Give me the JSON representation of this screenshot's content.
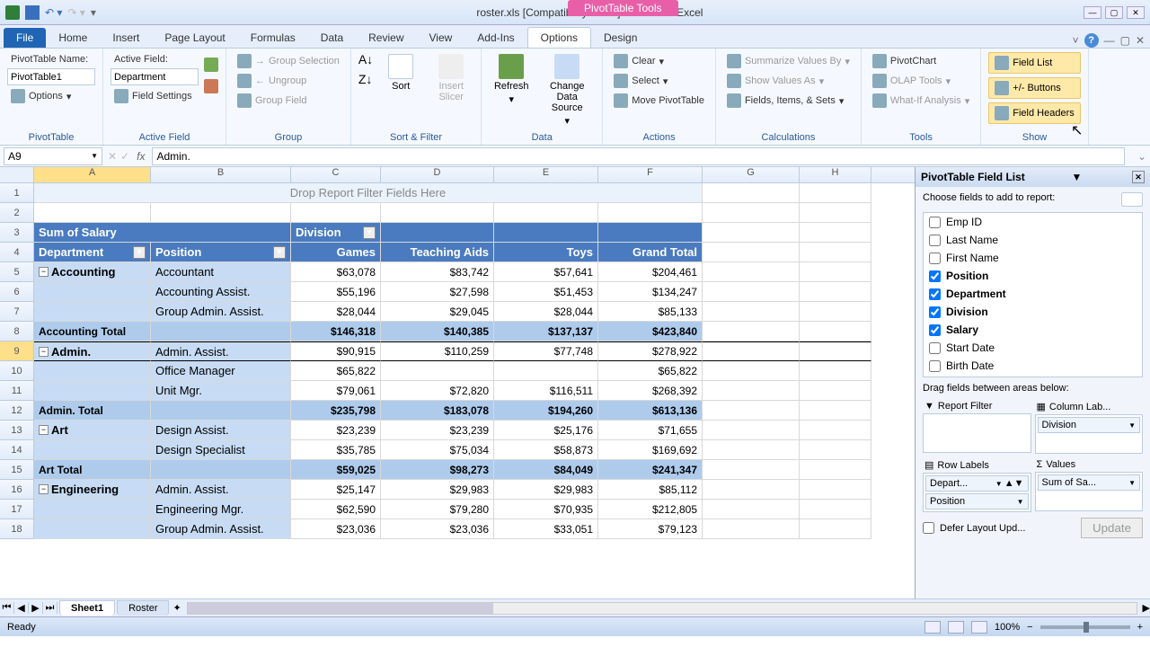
{
  "window": {
    "title": "roster.xls  [Compatibility Mode] - Microsoft Excel",
    "contextTab": "PivotTable Tools"
  },
  "tabs": [
    "File",
    "Home",
    "Insert",
    "Page Layout",
    "Formulas",
    "Data",
    "Review",
    "View",
    "Add-Ins",
    "Options",
    "Design"
  ],
  "ribbon": {
    "pivottable": {
      "nameLabel": "PivotTable Name:",
      "name": "PivotTable1",
      "options": "Options",
      "group": "PivotTable"
    },
    "activefield": {
      "label": "Active Field:",
      "value": "Department",
      "settings": "Field Settings",
      "group": "Active Field"
    },
    "group": {
      "sel": "Group Selection",
      "ungroup": "Ungroup",
      "field": "Group Field",
      "group": "Group"
    },
    "sortfilter": {
      "sort": "Sort",
      "slicer": "Insert Slicer",
      "group": "Sort & Filter"
    },
    "data": {
      "refresh": "Refresh",
      "change": "Change Data Source",
      "group": "Data"
    },
    "actions": {
      "clear": "Clear",
      "select": "Select",
      "move": "Move PivotTable",
      "group": "Actions"
    },
    "calc": {
      "summarize": "Summarize Values By",
      "showas": "Show Values As",
      "fields": "Fields, Items, & Sets",
      "group": "Calculations"
    },
    "tools": {
      "chart": "PivotChart",
      "olap": "OLAP Tools",
      "whatif": "What-If Analysis",
      "group": "Tools"
    },
    "show": {
      "list": "Field List",
      "buttons": "+/- Buttons",
      "headers": "Field Headers",
      "group": "Show"
    }
  },
  "fbar": {
    "name": "A9",
    "formula": "Admin."
  },
  "colLetters": [
    "A",
    "B",
    "C",
    "D",
    "E",
    "F",
    "G",
    "H"
  ],
  "pivot": {
    "filterDrop": "Drop Report Filter Fields Here",
    "corner": "Sum of Salary",
    "colField": "Division",
    "rowFields": [
      "Department",
      "Position"
    ],
    "cols": [
      "Games",
      "Teaching Aids",
      "Toys",
      "Grand Total"
    ]
  },
  "chart_data": {
    "type": "table",
    "value_field": "Sum of Salary",
    "column_field": "Division",
    "columns": [
      "Games",
      "Teaching Aids",
      "Toys",
      "Grand Total"
    ],
    "rows": [
      {
        "dept": "Accounting",
        "pos": "Accountant",
        "vals": [
          "$63,078",
          "$83,742",
          "$57,641",
          "$204,461"
        ]
      },
      {
        "dept": "Accounting",
        "pos": "Accounting Assist.",
        "vals": [
          "$55,196",
          "$27,598",
          "$51,453",
          "$134,247"
        ]
      },
      {
        "dept": "Accounting",
        "pos": "Group Admin. Assist.",
        "vals": [
          "$28,044",
          "$29,045",
          "$28,044",
          "$85,133"
        ]
      },
      {
        "dept": "Accounting Total",
        "subtotal": true,
        "vals": [
          "$146,318",
          "$140,385",
          "$137,137",
          "$423,840"
        ]
      },
      {
        "dept": "Admin.",
        "pos": "Admin. Assist.",
        "vals": [
          "$90,915",
          "$110,259",
          "$77,748",
          "$278,922"
        ]
      },
      {
        "dept": "Admin.",
        "pos": "Office Manager",
        "vals": [
          "$65,822",
          "",
          "",
          "$65,822"
        ]
      },
      {
        "dept": "Admin.",
        "pos": "Unit Mgr.",
        "vals": [
          "$79,061",
          "$72,820",
          "$116,511",
          "$268,392"
        ]
      },
      {
        "dept": "Admin. Total",
        "subtotal": true,
        "vals": [
          "$235,798",
          "$183,078",
          "$194,260",
          "$613,136"
        ]
      },
      {
        "dept": "Art",
        "pos": "Design Assist.",
        "vals": [
          "$23,239",
          "$23,239",
          "$25,176",
          "$71,655"
        ]
      },
      {
        "dept": "Art",
        "pos": "Design Specialist",
        "vals": [
          "$35,785",
          "$75,034",
          "$58,873",
          "$169,692"
        ]
      },
      {
        "dept": "Art Total",
        "subtotal": true,
        "vals": [
          "$59,025",
          "$98,273",
          "$84,049",
          "$241,347"
        ]
      },
      {
        "dept": "Engineering",
        "pos": "Admin. Assist.",
        "vals": [
          "$25,147",
          "$29,983",
          "$29,983",
          "$85,112"
        ]
      },
      {
        "dept": "Engineering",
        "pos": "Engineering Mgr.",
        "vals": [
          "$62,590",
          "$79,280",
          "$70,935",
          "$212,805"
        ]
      },
      {
        "dept": "Engineering",
        "pos": "Group Admin. Assist.",
        "vals": [
          "$23,036",
          "$23,036",
          "$33,051",
          "$79,123"
        ]
      }
    ]
  },
  "fieldlist": {
    "title": "PivotTable Field List",
    "instr": "Choose fields to add to report:",
    "fields": [
      {
        "name": "Emp ID",
        "checked": false
      },
      {
        "name": "Last Name",
        "checked": false
      },
      {
        "name": "First Name",
        "checked": false
      },
      {
        "name": "Position",
        "checked": true
      },
      {
        "name": "Department",
        "checked": true
      },
      {
        "name": "Division",
        "checked": true
      },
      {
        "name": "Salary",
        "checked": true
      },
      {
        "name": "Start Date",
        "checked": false
      },
      {
        "name": "Birth Date",
        "checked": false
      }
    ],
    "dragLabel": "Drag fields between areas below:",
    "areas": {
      "filter": "Report Filter",
      "cols": "Column Lab...",
      "rows": "Row Labels",
      "vals": "Values",
      "colChips": [
        "Division"
      ],
      "rowChips": [
        "Depart...",
        "Position"
      ],
      "valChips": [
        "Sum of Sa..."
      ]
    },
    "defer": "Defer Layout Upd...",
    "update": "Update"
  },
  "sheets": [
    "Sheet1",
    "Roster"
  ],
  "status": {
    "ready": "Ready",
    "zoom": "100%"
  }
}
